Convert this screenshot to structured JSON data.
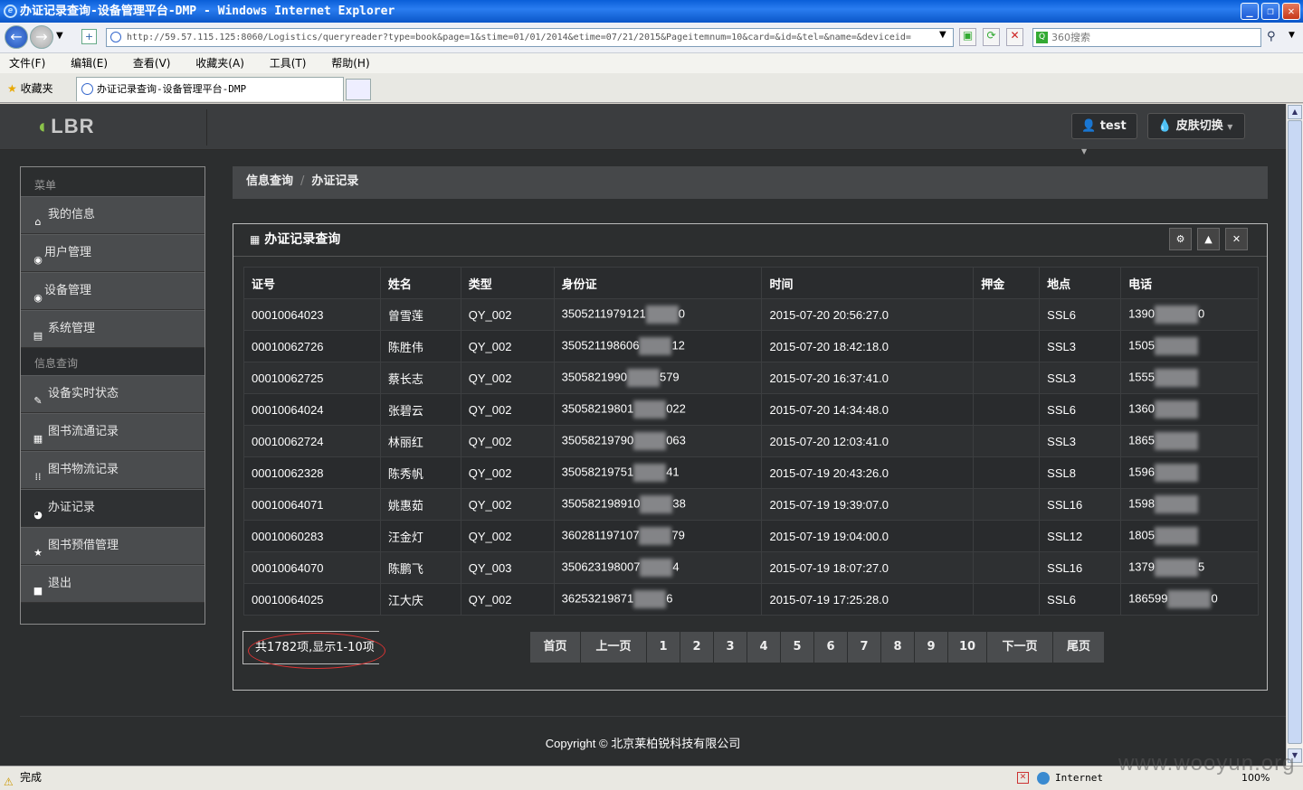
{
  "window": {
    "title": "办证记录查询-设备管理平台-DMP - Windows Internet Explorer",
    "minimize": "_",
    "maximize": "❐",
    "close": "✕"
  },
  "browser": {
    "url": "http://59.57.115.125:8060/Logistics/queryreader?type=book&page=1&stime=01/01/2014&etime=07/21/2015&Pageitemnum=10&card=&id=&tel=&name=&deviceid=",
    "search_placeholder": "360搜索",
    "menu": [
      "文件(F)",
      "编辑(E)",
      "查看(V)",
      "收藏夹(A)",
      "工具(T)",
      "帮助(H)"
    ],
    "favorites_label": "收藏夹",
    "tab_title": "办证记录查询-设备管理平台-DMP",
    "status_text": "完成",
    "zone": "Internet",
    "zoom": "100%"
  },
  "app": {
    "logo": "LBR",
    "user_button": "test",
    "skin_button": "皮肤切换"
  },
  "sidebar": {
    "section1": "菜单",
    "section2": "信息查询",
    "items1": [
      {
        "label": "我的信息",
        "icon": "home-icon"
      },
      {
        "label": "用户管理",
        "icon": "eye-icon"
      },
      {
        "label": "设备管理",
        "icon": "eye-icon"
      },
      {
        "label": "系统管理",
        "icon": "list-icon"
      }
    ],
    "items2": [
      {
        "label": "设备实时状态",
        "icon": "edit-icon"
      },
      {
        "label": "图书流通记录",
        "icon": "calendar-icon"
      },
      {
        "label": "图书物流记录",
        "icon": "grid-icon"
      },
      {
        "label": "办证记录",
        "icon": "globe-icon",
        "active": true
      },
      {
        "label": "图书预借管理",
        "icon": "star-icon"
      },
      {
        "label": "退出",
        "icon": "lock-icon"
      }
    ]
  },
  "breadcrumb": {
    "parent": "信息查询",
    "current": "办证记录"
  },
  "panel": {
    "title": "办证记录查询"
  },
  "table": {
    "headers": [
      "证号",
      "姓名",
      "类型",
      "身份证",
      "时间",
      "押金",
      "地点",
      "电话"
    ],
    "rows": [
      [
        "00010064023",
        "曾雪莲",
        "QY_002",
        "3505211979121",
        "0",
        "2015-07-20 20:56:27.0",
        "",
        "SSL6",
        "1390",
        "0"
      ],
      [
        "00010062726",
        "陈胜伟",
        "QY_002",
        "350521198606",
        "12",
        "2015-07-20 18:42:18.0",
        "",
        "SSL3",
        "1505",
        ""
      ],
      [
        "00010062725",
        "蔡长志",
        "QY_002",
        "3505821990",
        "579",
        "2015-07-20 16:37:41.0",
        "",
        "SSL3",
        "1555",
        ""
      ],
      [
        "00010064024",
        "张碧云",
        "QY_002",
        "35058219801",
        "022",
        "2015-07-20 14:34:48.0",
        "",
        "SSL6",
        "1360",
        ""
      ],
      [
        "00010062724",
        "林丽红",
        "QY_002",
        "35058219790",
        "063",
        "2015-07-20 12:03:41.0",
        "",
        "SSL3",
        "1865",
        ""
      ],
      [
        "00010062328",
        "陈秀帆",
        "QY_002",
        "35058219751",
        "41",
        "2015-07-19 20:43:26.0",
        "",
        "SSL8",
        "1596",
        ""
      ],
      [
        "00010064071",
        "姚惠茹",
        "QY_002",
        "350582198910",
        "38",
        "2015-07-19 19:39:07.0",
        "",
        "SSL16",
        "1598",
        ""
      ],
      [
        "00010060283",
        "汪金灯",
        "QY_002",
        "360281197107",
        "79",
        "2015-07-19 19:04:00.0",
        "",
        "SSL12",
        "1805",
        ""
      ],
      [
        "00010064070",
        "陈鹏飞",
        "QY_003",
        "350623198007",
        "4",
        "2015-07-19 18:07:27.0",
        "",
        "SSL16",
        "1379",
        "5"
      ],
      [
        "00010064025",
        "江大庆",
        "QY_002",
        "36253219871",
        "6",
        "2015-07-19 17:25:28.0",
        "",
        "SSL6",
        "186599",
        "0"
      ]
    ]
  },
  "pagination": {
    "summary": "共1782项,显示1-10项",
    "first": "首页",
    "prev": "上一页",
    "pages": [
      "1",
      "2",
      "3",
      "4",
      "5",
      "6",
      "7",
      "8",
      "9",
      "10"
    ],
    "next": "下一页",
    "last": "尾页"
  },
  "footer": {
    "copyright": "Copyright ©   北京莱柏锐科技有限公司"
  },
  "watermark": "www.wooyun.org"
}
